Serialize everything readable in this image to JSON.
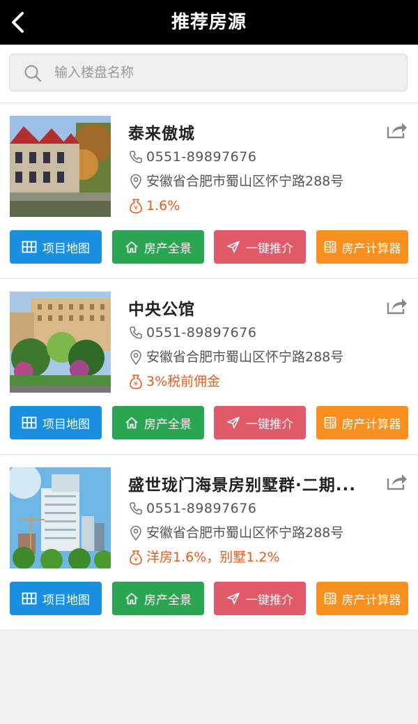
{
  "header": {
    "title": "推荐房源"
  },
  "search": {
    "placeholder": "输入楼盘名称"
  },
  "buttons": {
    "map": "项目地图",
    "panorama": "房产全景",
    "recommend": "一键推介",
    "calculator": "房产计算器"
  },
  "properties": [
    {
      "name": "泰来傲城",
      "phone": "0551-89897676",
      "address": "安徽省合肥市蜀山区怀宁路288号",
      "commission": "1.6%"
    },
    {
      "name": "中央公馆",
      "phone": "0551-89897676",
      "address": "安徽省合肥市蜀山区怀宁路288号",
      "commission": "3%税前佣金"
    },
    {
      "name": "盛世珑门海景房别墅群·二期...",
      "phone": "0551-89897676",
      "address": "安徽省合肥市蜀山区怀宁路288号",
      "commission": "洋房1.6%，别墅1.2%"
    }
  ],
  "colors": {
    "topbar": "#000000",
    "map_button": "#1a8fe0",
    "panorama_button": "#2aa552",
    "recommend_button": "#e05a6a",
    "calculator_button": "#f7901e",
    "commission_text": "#f05a1a"
  },
  "icons": [
    "back-icon",
    "search-icon",
    "share-icon",
    "phone-icon",
    "location-icon",
    "money-bag-icon",
    "map-grid-icon",
    "home-icon",
    "send-icon",
    "calculator-icon"
  ]
}
